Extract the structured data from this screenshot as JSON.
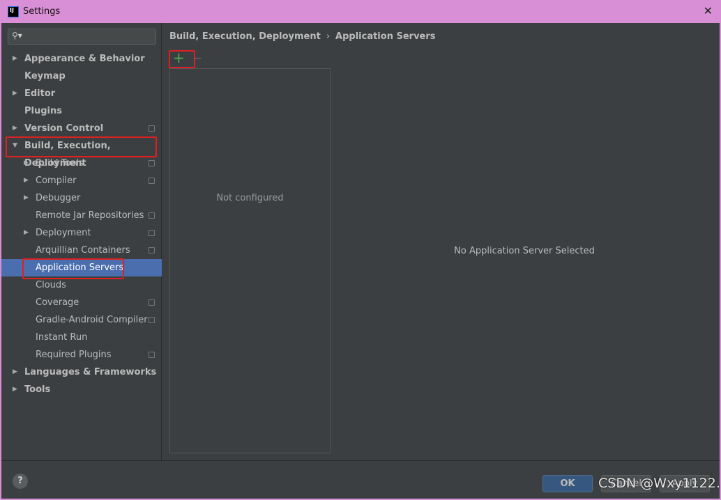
{
  "window": {
    "title": "Settings",
    "close": "✕"
  },
  "search": {
    "icon": "search-icon",
    "glyph": "⚲▾"
  },
  "tree": [
    {
      "label": "Appearance & Behavior",
      "level": 0,
      "arrow": "▶",
      "proj": false
    },
    {
      "label": "Keymap",
      "level": 0,
      "arrow": "",
      "proj": false
    },
    {
      "label": "Editor",
      "level": 0,
      "arrow": "▶",
      "proj": false
    },
    {
      "label": "Plugins",
      "level": 0,
      "arrow": "",
      "proj": false
    },
    {
      "label": "Version Control",
      "level": 0,
      "arrow": "▶",
      "proj": true
    },
    {
      "label": "Build, Execution, Deployment",
      "level": 0,
      "arrow": "▼",
      "proj": false
    },
    {
      "label": "Build Tools",
      "level": 1,
      "arrow": "▶",
      "proj": true
    },
    {
      "label": "Compiler",
      "level": 1,
      "arrow": "▶",
      "proj": true
    },
    {
      "label": "Debugger",
      "level": 1,
      "arrow": "▶",
      "proj": false
    },
    {
      "label": "Remote Jar Repositories",
      "level": 1,
      "arrow": "",
      "proj": true
    },
    {
      "label": "Deployment",
      "level": 1,
      "arrow": "▶",
      "proj": true
    },
    {
      "label": "Arquillian Containers",
      "level": 1,
      "arrow": "",
      "proj": true
    },
    {
      "label": "Application Servers",
      "level": 1,
      "arrow": "",
      "proj": false,
      "selected": true
    },
    {
      "label": "Clouds",
      "level": 1,
      "arrow": "",
      "proj": false
    },
    {
      "label": "Coverage",
      "level": 1,
      "arrow": "",
      "proj": true
    },
    {
      "label": "Gradle-Android Compiler",
      "level": 1,
      "arrow": "",
      "proj": true
    },
    {
      "label": "Instant Run",
      "level": 1,
      "arrow": "",
      "proj": false
    },
    {
      "label": "Required Plugins",
      "level": 1,
      "arrow": "",
      "proj": true
    },
    {
      "label": "Languages & Frameworks",
      "level": 0,
      "arrow": "▶",
      "proj": false
    },
    {
      "label": "Tools",
      "level": 0,
      "arrow": "▶",
      "proj": false
    }
  ],
  "breadcrumb": {
    "parent": "Build, Execution, Deployment",
    "sep": "›",
    "current": "Application Servers"
  },
  "toolbar": {
    "add": "+",
    "remove": "−"
  },
  "list": {
    "empty_text": "Not configured"
  },
  "detail": {
    "empty_text": "No Application Server Selected"
  },
  "footer": {
    "help": "?",
    "ok": "OK",
    "cancel": "Cancel",
    "apply": "Apply"
  },
  "watermark": "CSDN @Wxy1122.",
  "colors": {
    "selection": "#4b6eaf",
    "highlight": "#e02020",
    "add": "#49b04a"
  }
}
